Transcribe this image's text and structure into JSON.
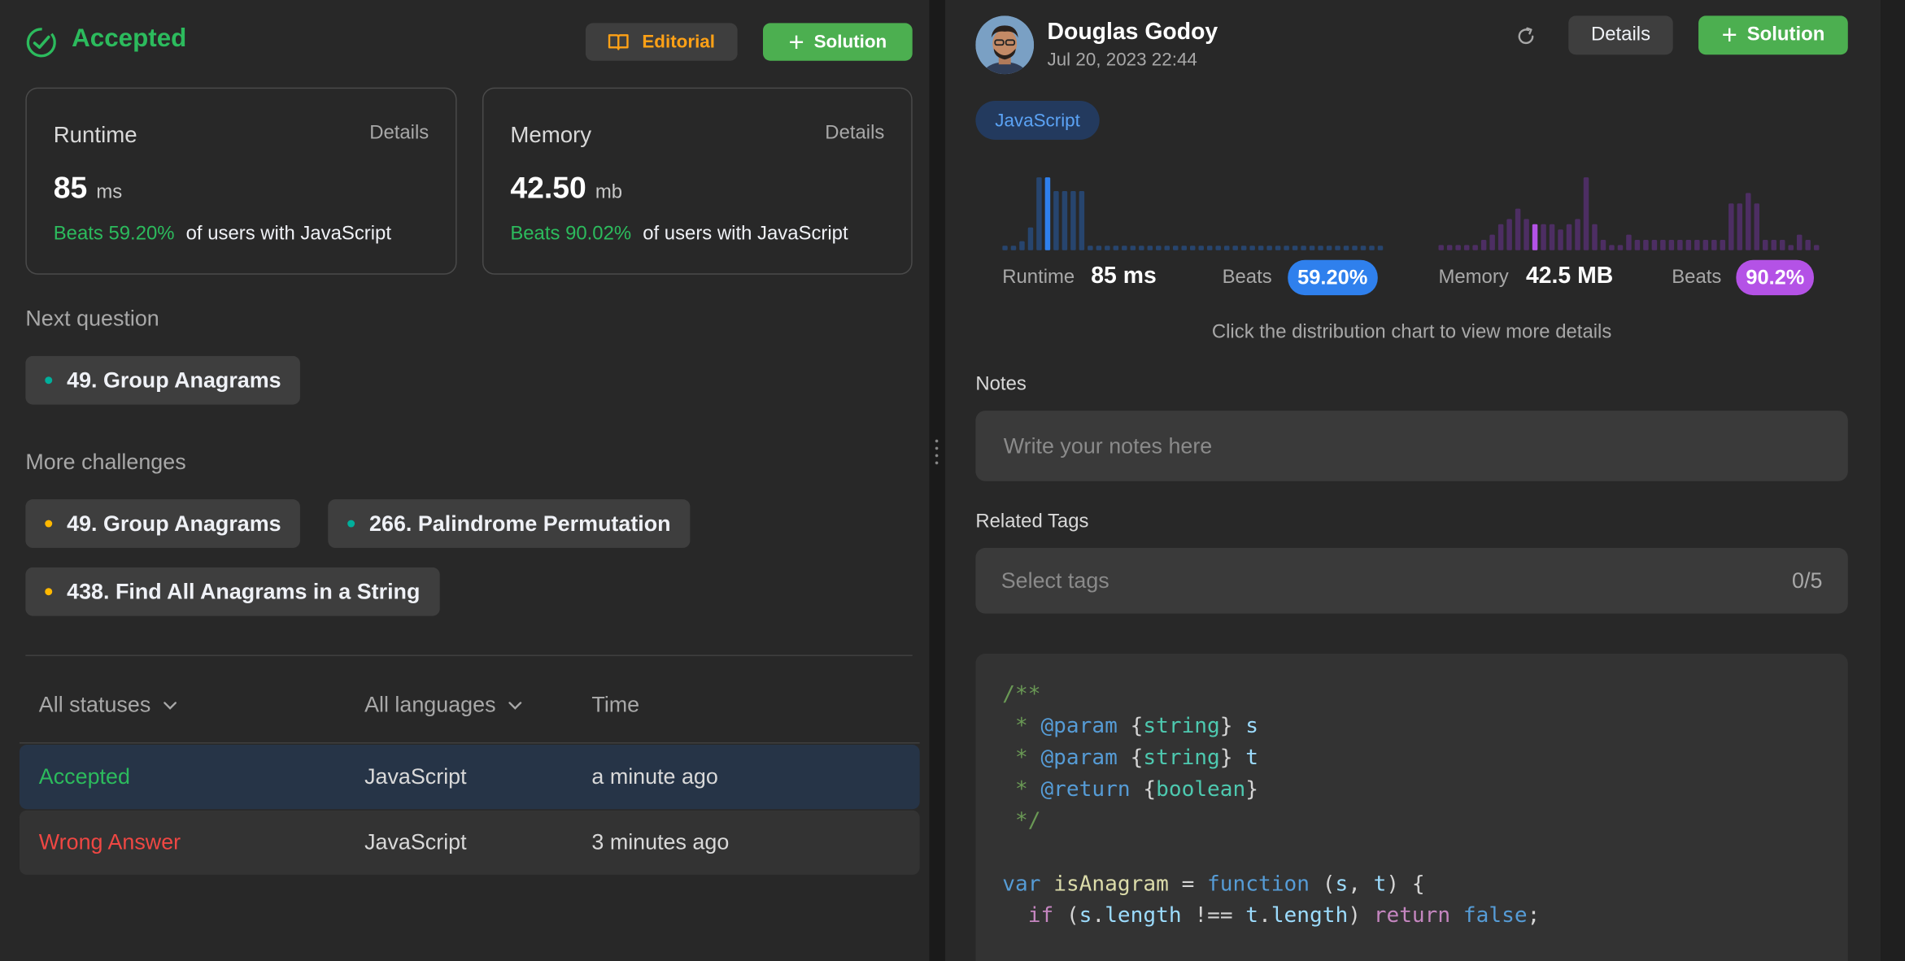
{
  "left": {
    "status": "Accepted",
    "editorial_label": "Editorial",
    "solution_label": "Solution",
    "runtime": {
      "title": "Runtime",
      "details": "Details",
      "value": "85",
      "unit": "ms",
      "beats": "Beats 59.20%",
      "suffix": "of users with JavaScript"
    },
    "memory": {
      "title": "Memory",
      "details": "Details",
      "value": "42.50",
      "unit": "mb",
      "beats": "Beats 90.02%",
      "suffix": "of users with JavaScript"
    },
    "next_question_heading": "Next question",
    "next_question": "49. Group Anagrams",
    "more_challenges_heading": "More challenges",
    "challenges": [
      "49. Group Anagrams",
      "266. Palindrome Permutation",
      "438. Find All Anagrams in a String"
    ],
    "filter_status": "All statuses",
    "filter_language": "All languages",
    "time_header": "Time",
    "submissions": [
      {
        "status": "Accepted",
        "language": "JavaScript",
        "time": "a minute ago"
      },
      {
        "status": "Wrong Answer",
        "language": "JavaScript",
        "time": "3 minutes ago"
      }
    ]
  },
  "right": {
    "author": "Douglas Godoy",
    "date": "Jul 20, 2023 22:44",
    "details_label": "Details",
    "solution_label": "Solution",
    "language_badge": "JavaScript",
    "runtime_label": "Runtime",
    "runtime_value": "85 ms",
    "runtime_beats_label": "Beats",
    "runtime_beats": "59.20%",
    "memory_label": "Memory",
    "memory_value": "42.5 MB",
    "memory_beats_label": "Beats",
    "memory_beats": "90.2%",
    "chart_hint": "Click the distribution chart to view more details",
    "notes_heading": "Notes",
    "notes_placeholder": "Write your notes here",
    "tags_heading": "Related Tags",
    "tags_placeholder": "Select tags",
    "tags_count": "0/5"
  },
  "colors": {
    "accepted": "#2cbb5d",
    "wrong": "#ef4743",
    "editorial": "#ffa116",
    "runtime_accent": "#2f80ed",
    "memory_accent": "#b452e6"
  },
  "chart_data": [
    {
      "type": "bar",
      "series_label": "Runtime",
      "values": [
        1,
        1,
        2,
        5,
        16,
        16,
        13,
        13,
        13,
        13,
        1,
        1,
        1,
        1,
        1,
        1,
        1,
        1,
        1,
        1,
        1,
        1,
        1,
        1,
        1,
        1,
        1,
        1,
        1,
        1,
        1,
        1,
        1,
        1,
        1,
        1,
        1,
        1,
        1,
        1,
        1,
        1,
        1,
        1,
        1
      ],
      "highlight_index": 5
    },
    {
      "type": "bar",
      "series_label": "Memory",
      "values": [
        1,
        1,
        1,
        1,
        1,
        2,
        3,
        5,
        6,
        8,
        6,
        5,
        5,
        5,
        4,
        5,
        6,
        14,
        5,
        2,
        1,
        1,
        3,
        2,
        2,
        2,
        2,
        2,
        2,
        2,
        2,
        2,
        2,
        2,
        9,
        9,
        11,
        9,
        2,
        2,
        2,
        1,
        3,
        2,
        1
      ],
      "highlight_index": 11
    }
  ],
  "code": {
    "lines": [
      [
        [
          "c-com",
          "/**"
        ]
      ],
      [
        [
          "c-com",
          " * "
        ],
        [
          "c-tag",
          "@param"
        ],
        [
          "c-txt",
          " {"
        ],
        [
          "c-type",
          "string"
        ],
        [
          "c-txt",
          "} "
        ],
        [
          "c-var",
          "s"
        ]
      ],
      [
        [
          "c-com",
          " * "
        ],
        [
          "c-tag",
          "@param"
        ],
        [
          "c-txt",
          " {"
        ],
        [
          "c-type",
          "string"
        ],
        [
          "c-txt",
          "} "
        ],
        [
          "c-var",
          "t"
        ]
      ],
      [
        [
          "c-com",
          " * "
        ],
        [
          "c-tag",
          "@return"
        ],
        [
          "c-txt",
          " {"
        ],
        [
          "c-type",
          "boolean"
        ],
        [
          "c-txt",
          "}"
        ]
      ],
      [
        [
          "c-com",
          " */"
        ]
      ],
      [
        [
          "c-txt",
          ""
        ]
      ],
      [
        [
          "c-kw",
          "var"
        ],
        [
          "c-txt",
          " "
        ],
        [
          "c-fn",
          "isAnagram"
        ],
        [
          "c-txt",
          " = "
        ],
        [
          "c-kw",
          "function"
        ],
        [
          "c-txt",
          " ("
        ],
        [
          "c-var",
          "s"
        ],
        [
          "c-txt",
          ", "
        ],
        [
          "c-var",
          "t"
        ],
        [
          "c-txt",
          ") {"
        ]
      ],
      [
        [
          "c-txt",
          "  "
        ],
        [
          "c-ctl",
          "if"
        ],
        [
          "c-txt",
          " ("
        ],
        [
          "c-var",
          "s"
        ],
        [
          "c-txt",
          "."
        ],
        [
          "c-var",
          "length"
        ],
        [
          "c-txt",
          " !== "
        ],
        [
          "c-var",
          "t"
        ],
        [
          "c-txt",
          "."
        ],
        [
          "c-var",
          "length"
        ],
        [
          "c-txt",
          ") "
        ],
        [
          "c-ctl",
          "return"
        ],
        [
          "c-txt",
          " "
        ],
        [
          "c-kw",
          "false"
        ],
        [
          "c-txt",
          ";"
        ]
      ]
    ]
  }
}
